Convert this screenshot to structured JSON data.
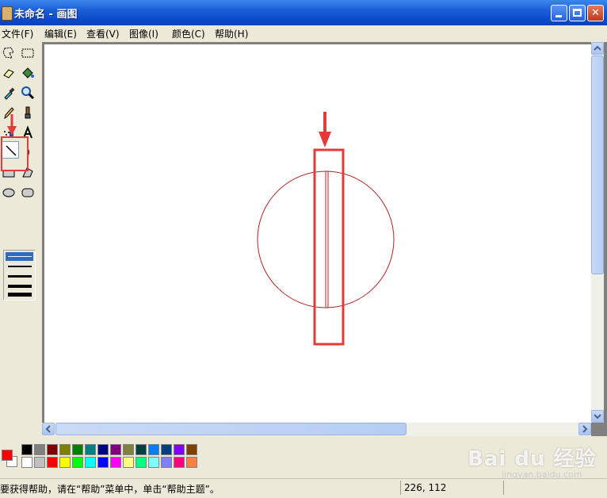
{
  "window": {
    "title": "未命名 - 画图"
  },
  "menu": {
    "items": [
      "文件(F)",
      "编辑(E)",
      "查看(V)",
      "图像(I)",
      "颜色(C)",
      "帮助(H)"
    ]
  },
  "toolbox": {
    "tools": [
      "free-form-select",
      "select",
      "eraser",
      "fill-with-color",
      "pick-color",
      "magnifier",
      "pencil",
      "brush",
      "airbrush",
      "text",
      "line",
      "curve",
      "rectangle",
      "polygon",
      "ellipse",
      "rounded-rectangle"
    ],
    "selected_tool": "line",
    "selected_line_width": 1
  },
  "canvas": {
    "drawing": "red circle with vertical narrow rectangle",
    "stroke_color": "#b22222"
  },
  "annotations": {
    "highlight_color": "#e53a3a"
  },
  "palette": {
    "foreground": "#ff0000",
    "background": "#ffffff",
    "row1": [
      "#000000",
      "#808080",
      "#800000",
      "#808000",
      "#008000",
      "#008080",
      "#000080",
      "#800080",
      "#808040",
      "#004040",
      "#0080ff",
      "#004080",
      "#8000ff",
      "#804000"
    ],
    "row2": [
      "#ffffff",
      "#c0c0c0",
      "#ff0000",
      "#ffff00",
      "#00ff00",
      "#00ffff",
      "#0000ff",
      "#ff00ff",
      "#ffff80",
      "#00ff80",
      "#80ffff",
      "#8080ff",
      "#ff0080",
      "#ff8040"
    ]
  },
  "status": {
    "help_text": "要获得帮助，请在“帮助”菜单中，单击“帮助主题”。",
    "coords": "226, 112"
  },
  "watermark": {
    "main": "Bai du 经验",
    "sub": "jingyan.baidu.com"
  }
}
